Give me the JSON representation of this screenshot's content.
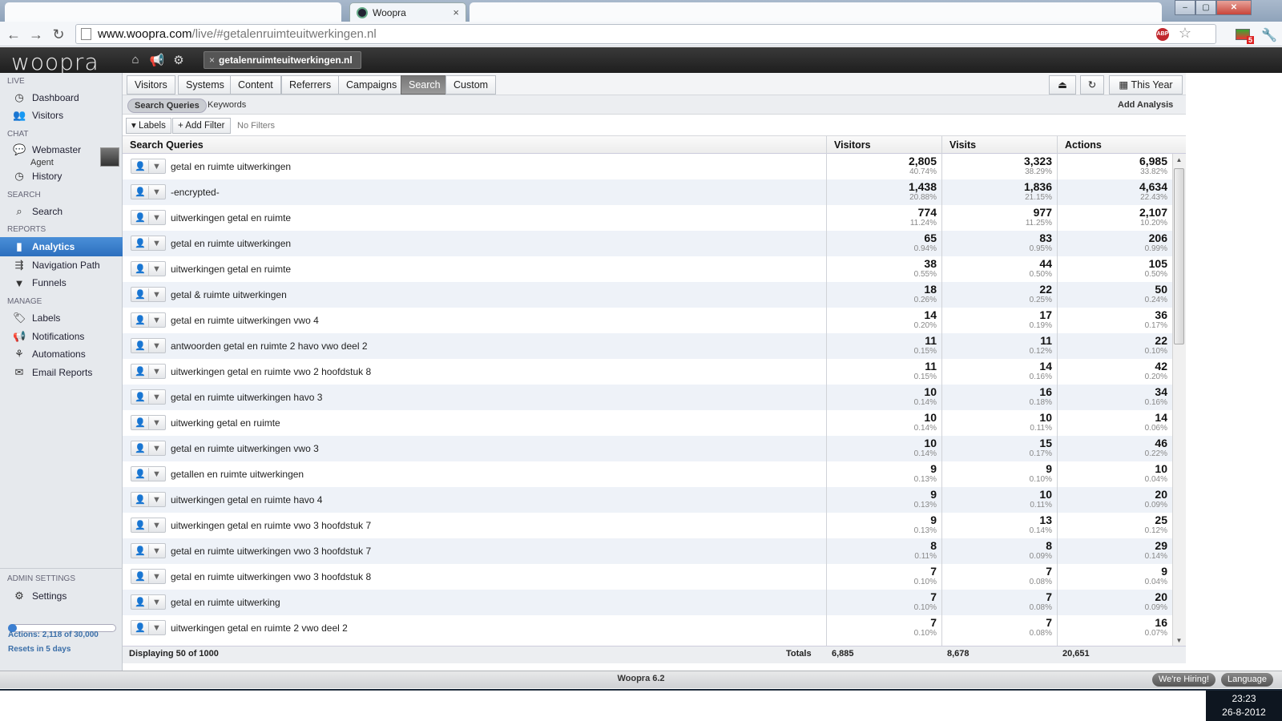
{
  "browser": {
    "tab_title": "Woopra",
    "tab_close": "×",
    "url_host": "www.woopra.com",
    "url_path": "/live/#getalenruimteuitwerkingen.nl",
    "abp_label": "ABP",
    "ext_badge": "5",
    "window_controls": [
      "–",
      "▢",
      "✕"
    ]
  },
  "app": {
    "logo": "woopra",
    "site_tag": "getalenruimteuitwerkingen.nl",
    "site_tag_close": "×"
  },
  "sidebar": {
    "live_heading": "LIVE",
    "dashboard": "Dashboard",
    "visitors": "Visitors",
    "chat_heading": "CHAT",
    "agent_name": "Webmaster",
    "agent_role": "Agent",
    "history": "History",
    "search_heading": "SEARCH",
    "search": "Search",
    "reports_heading": "REPORTS",
    "analytics": "Analytics",
    "navigation_path": "Navigation Path",
    "funnels": "Funnels",
    "manage_heading": "MANAGE",
    "labels": "Labels",
    "notifications": "Notifications",
    "automations": "Automations",
    "email_reports": "Email Reports",
    "admin_heading": "ADMIN SETTINGS",
    "settings": "Settings",
    "actions_quota": "Actions: 2,118 of 30,000",
    "quota_fraction": 0.0706,
    "resets": "Resets in 5 days"
  },
  "report_tabs": [
    "Visitors",
    "Systems",
    "Content",
    "Referrers",
    "Campaigns",
    "Search",
    "Custom"
  ],
  "active_tab": "Search",
  "date_range": "This Year",
  "subtabs": {
    "queries": "Search Queries",
    "keywords": "Keywords",
    "add_analysis": "Add Analysis"
  },
  "filters": {
    "labels": "Labels",
    "add_filter": "Add Filter",
    "none": "No Filters"
  },
  "table": {
    "headers": [
      "Search Queries",
      "Visitors",
      "Visits",
      "Actions"
    ],
    "rows": [
      {
        "q": "getal en ruimte uitwerkingen",
        "v": "2,805",
        "vp": "40.74%",
        "s": "3,323",
        "sp": "38.29%",
        "a": "6,985",
        "ap": "33.82%"
      },
      {
        "q": "-encrypted-",
        "v": "1,438",
        "vp": "20.88%",
        "s": "1,836",
        "sp": "21.15%",
        "a": "4,634",
        "ap": "22.43%"
      },
      {
        "q": "uitwerkingen getal en ruimte",
        "v": "774",
        "vp": "11.24%",
        "s": "977",
        "sp": "11.25%",
        "a": "2,107",
        "ap": "10.20%"
      },
      {
        "q": "getal en ruimte uitwerkingen",
        "v": "65",
        "vp": "0.94%",
        "s": "83",
        "sp": "0.95%",
        "a": "206",
        "ap": "0.99%"
      },
      {
        "q": "uitwerkingen getal en ruimte",
        "v": "38",
        "vp": "0.55%",
        "s": "44",
        "sp": "0.50%",
        "a": "105",
        "ap": "0.50%"
      },
      {
        "q": "getal & ruimte uitwerkingen",
        "v": "18",
        "vp": "0.26%",
        "s": "22",
        "sp": "0.25%",
        "a": "50",
        "ap": "0.24%"
      },
      {
        "q": "getal en ruimte uitwerkingen vwo 4",
        "v": "14",
        "vp": "0.20%",
        "s": "17",
        "sp": "0.19%",
        "a": "36",
        "ap": "0.17%"
      },
      {
        "q": "antwoorden getal en ruimte 2 havo vwo deel 2",
        "v": "11",
        "vp": "0.15%",
        "s": "11",
        "sp": "0.12%",
        "a": "22",
        "ap": "0.10%"
      },
      {
        "q": "uitwerkingen getal en ruimte vwo 2 hoofdstuk 8",
        "v": "11",
        "vp": "0.15%",
        "s": "14",
        "sp": "0.16%",
        "a": "42",
        "ap": "0.20%"
      },
      {
        "q": "getal en ruimte uitwerkingen havo 3",
        "v": "10",
        "vp": "0.14%",
        "s": "16",
        "sp": "0.18%",
        "a": "34",
        "ap": "0.16%"
      },
      {
        "q": "uitwerking getal en ruimte",
        "v": "10",
        "vp": "0.14%",
        "s": "10",
        "sp": "0.11%",
        "a": "14",
        "ap": "0.06%"
      },
      {
        "q": "getal en ruimte uitwerkingen vwo 3",
        "v": "10",
        "vp": "0.14%",
        "s": "15",
        "sp": "0.17%",
        "a": "46",
        "ap": "0.22%"
      },
      {
        "q": "getallen en ruimte uitwerkingen",
        "v": "9",
        "vp": "0.13%",
        "s": "9",
        "sp": "0.10%",
        "a": "10",
        "ap": "0.04%"
      },
      {
        "q": "uitwerkingen getal en ruimte havo 4",
        "v": "9",
        "vp": "0.13%",
        "s": "10",
        "sp": "0.11%",
        "a": "20",
        "ap": "0.09%"
      },
      {
        "q": "uitwerkingen getal en ruimte vwo 3 hoofdstuk 7",
        "v": "9",
        "vp": "0.13%",
        "s": "13",
        "sp": "0.14%",
        "a": "25",
        "ap": "0.12%"
      },
      {
        "q": "getal en ruimte uitwerkingen vwo 3 hoofdstuk 7",
        "v": "8",
        "vp": "0.11%",
        "s": "8",
        "sp": "0.09%",
        "a": "29",
        "ap": "0.14%"
      },
      {
        "q": "getal en ruimte uitwerkingen vwo 3 hoofdstuk 8",
        "v": "7",
        "vp": "0.10%",
        "s": "7",
        "sp": "0.08%",
        "a": "9",
        "ap": "0.04%"
      },
      {
        "q": "getal en ruimte uitwerking",
        "v": "7",
        "vp": "0.10%",
        "s": "7",
        "sp": "0.08%",
        "a": "20",
        "ap": "0.09%"
      },
      {
        "q": "uitwerkingen getal en ruimte 2 vwo deel 2",
        "v": "7",
        "vp": "0.10%",
        "s": "7",
        "sp": "0.08%",
        "a": "16",
        "ap": "0.07%"
      }
    ],
    "displaying": "Displaying 50 of 1000",
    "totals_label": "Totals",
    "totals": {
      "visitors": "6,885",
      "visits": "8,678",
      "actions": "20,651"
    }
  },
  "footer": {
    "version": "Woopra 6.2",
    "hiring": "We're Hiring!",
    "language": "Language"
  },
  "taskbar": {
    "time": "23:23",
    "date": "26-8-2012"
  }
}
